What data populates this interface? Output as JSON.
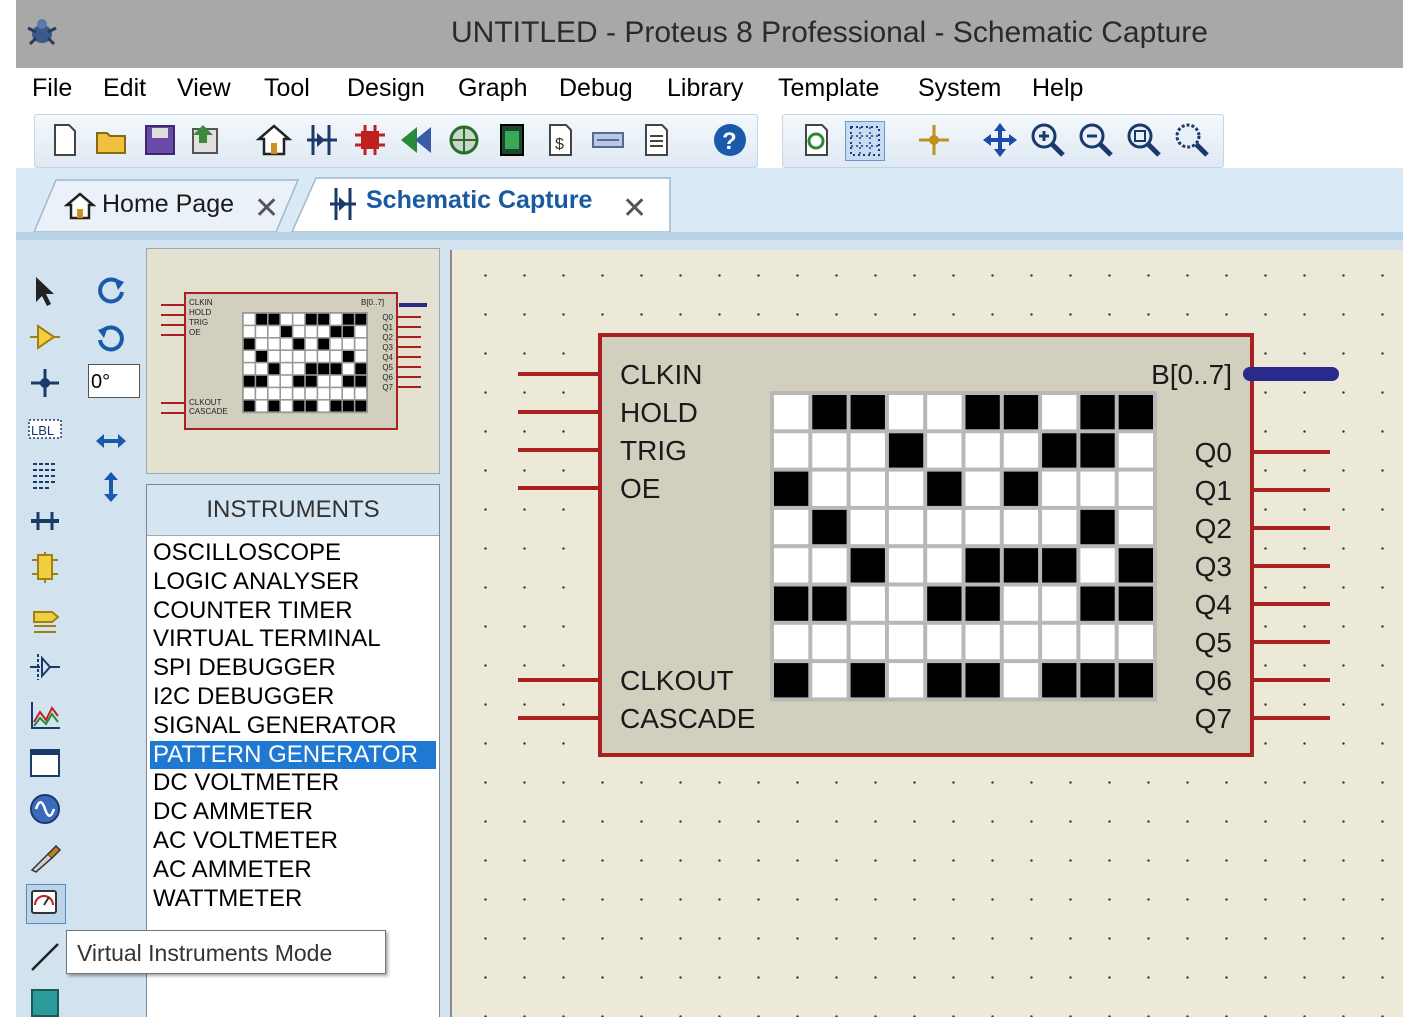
{
  "window": {
    "title": "UNTITLED - Proteus 8 Professional - Schematic Capture"
  },
  "menu": [
    "File",
    "Edit",
    "View",
    "Tool",
    "Design",
    "Graph",
    "Debug",
    "Library",
    "Template",
    "System",
    "Help"
  ],
  "tabs": [
    {
      "label": "Home Page",
      "active": false
    },
    {
      "label": "Schematic Capture",
      "active": true
    }
  ],
  "sidebar": {
    "rotation_value": "0°"
  },
  "instruments": {
    "header": "INSTRUMENTS",
    "items": [
      "OSCILLOSCOPE",
      "LOGIC ANALYSER",
      "COUNTER TIMER",
      "VIRTUAL TERMINAL",
      "SPI DEBUGGER",
      "I2C DEBUGGER",
      "SIGNAL GENERATOR",
      "PATTERN GENERATOR",
      "DC VOLTMETER",
      "DC AMMETER",
      "AC VOLTMETER",
      "AC AMMETER",
      "WATTMETER"
    ],
    "selected": "PATTERN GENERATOR"
  },
  "tooltip": "Virtual Instruments Mode",
  "component": {
    "left_pins": [
      "CLKIN",
      "HOLD",
      "TRIG",
      "OE",
      "CLKOUT",
      "CASCADE"
    ],
    "bus_pin": "B[0..7]",
    "right_pins": [
      "Q0",
      "Q1",
      "Q2",
      "Q3",
      "Q4",
      "Q5",
      "Q6",
      "Q7"
    ],
    "grid_pattern": [
      "0110011011",
      "0001000110",
      "1000101000",
      "0100000010",
      "0010011101",
      "1100110011",
      "0000000000",
      "1010110111"
    ]
  },
  "preview": {
    "clkin": "CLKIN",
    "hold": "HOLD",
    "trig": "TRIG",
    "oe": "OE",
    "clkout": "CLKOUT",
    "cascade": "CASCADE",
    "bus": "B[0..7]",
    "q_labels": [
      "Q0",
      "Q1",
      "Q2",
      "Q3",
      "Q4",
      "Q5",
      "Q6",
      "Q7"
    ]
  },
  "colors": {
    "pin_red": "#a82020",
    "bus_blue": "#2a2a8a",
    "body_fill": "#d2cfbe",
    "selected_item": "#1f78d1"
  }
}
